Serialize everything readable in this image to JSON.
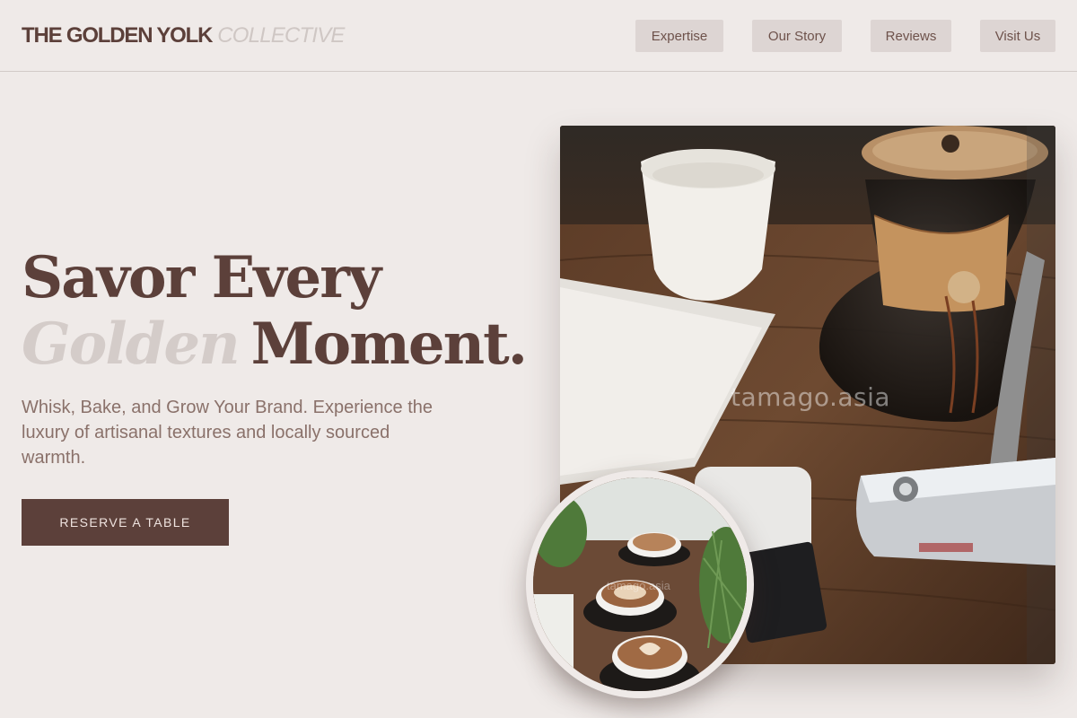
{
  "header": {
    "logo_brand": "THE GOLDEN YOLK",
    "logo_sub": "COLLECTIVE",
    "nav": [
      "Expertise",
      "Our Story",
      "Reviews",
      "Visit Us"
    ]
  },
  "hero": {
    "line1": "Savor Every",
    "line2_accent": "Golden",
    "line2_rest": "Moment.",
    "subcopy": "Whisk, Bake, and Grow Your Brand. Experience the luxury of artisanal textures and locally sourced warmth.",
    "cta_label": "RESERVE A TABLE"
  },
  "images": {
    "main_watermark": "tamago.asia",
    "circle_watermark": "tamago.asia"
  },
  "colors": {
    "background": "#efeae8",
    "primary": "#5c403a",
    "accent_light": "#d4ccc9",
    "nav_button": "#ddd5d3"
  }
}
